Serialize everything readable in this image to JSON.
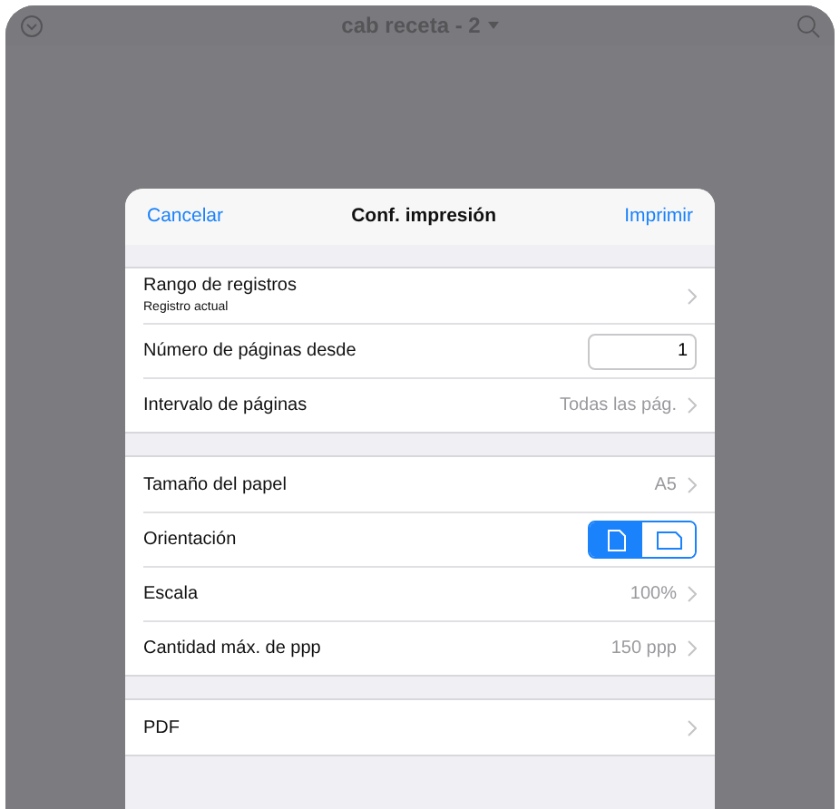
{
  "topbar": {
    "title": "cab receta - 2"
  },
  "dialog": {
    "cancel": "Cancelar",
    "title": "Conf. impresión",
    "confirm": "Imprimir"
  },
  "sections": [
    {
      "rows": [
        {
          "kind": "chevron",
          "label": "Rango de registros",
          "subtitle": "Registro actual"
        },
        {
          "kind": "input",
          "label": "Número de páginas desde",
          "value": "1"
        },
        {
          "kind": "chevron",
          "label": "Intervalo de páginas",
          "value": "Todas las pág."
        }
      ]
    },
    {
      "rows": [
        {
          "kind": "chevron",
          "label": "Tamaño del papel",
          "value": "A5"
        },
        {
          "kind": "segmented",
          "label": "Orientación",
          "options": [
            {
              "kind": "portrait",
              "selected": true
            },
            {
              "kind": "landscape",
              "selected": false
            }
          ]
        },
        {
          "kind": "chevron",
          "label": "Escala",
          "value": "100%"
        },
        {
          "kind": "chevron",
          "label": "Cantidad máx. de ppp",
          "value": "150 ppp"
        }
      ]
    },
    {
      "rows": [
        {
          "kind": "chevron",
          "label": "PDF"
        }
      ]
    }
  ]
}
